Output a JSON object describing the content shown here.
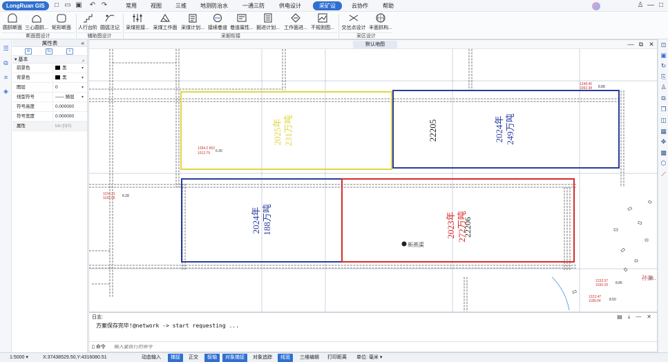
{
  "app": {
    "logo": "LongRuan GIS"
  },
  "menus": [
    {
      "label": "常用"
    },
    {
      "label": "视图"
    },
    {
      "label": "三维"
    },
    {
      "label": "地测防治水"
    },
    {
      "label": "一通三防"
    },
    {
      "label": "供电设计"
    },
    {
      "label": "采矿设计",
      "active": true
    },
    {
      "label": "云协作"
    },
    {
      "label": "帮助"
    }
  ],
  "ribbon": {
    "buttons": [
      "圆拱断面",
      "三心圆拱...",
      "矩形断面",
      "人行台阶",
      "圆弧注记",
      "采煤拒接...",
      "采煤工作面",
      "采煤计划...",
      "接续巷道",
      "巷道属性...",
      "掘进计划...",
      "工作面进...",
      "不规则图...",
      "交岔点设计",
      "丰面拱构..."
    ],
    "groups": [
      "断面图设计",
      "辅助图设计",
      "采掘衔接",
      "采区设计"
    ]
  },
  "props": {
    "title": "属性表",
    "collapse": "«",
    "tabs": [
      "⊞",
      "Sy",
      "≡"
    ],
    "section": "基本",
    "rows": [
      {
        "key": "前景色",
        "value": "黑",
        "swatch": true
      },
      {
        "key": "背景色",
        "value": "黑",
        "swatch": true
      },
      {
        "key": "图层",
        "value": "0"
      },
      {
        "key": "线型符号",
        "value": "—— 随层"
      },
      {
        "key": "符号高度",
        "value": "0.000000"
      },
      {
        "key": "符号宽度",
        "value": "0.000000"
      },
      {
        "key": "属性",
        "value": "bin:[0|0]"
      }
    ]
  },
  "map": {
    "tab": "默认地图",
    "labels": {
      "yellow": [
        "2025年",
        "231万吨"
      ],
      "blue_top": [
        "2024年",
        "249万吨"
      ],
      "id_top": "22205",
      "blue_left": [
        "2024年",
        "188万吨"
      ],
      "red": [
        "2023年",
        "272万吨"
      ],
      "id_red": "22206",
      "place1": "新燕渠",
      "place2": "孙家…",
      "pt1": "1284.2 852",
      "pt1b": "1012.79",
      "pt1v": "6.30",
      "pt2": "1248.45",
      "pt2b": "1092.38",
      "pt2v": "8.88",
      "pt3": "1154.21",
      "pt3b": "1182.06",
      "pt3v": "8.28",
      "pt4": "1232.57",
      "pt4b": "1030.29",
      "pt4v": "8.85",
      "pt5": "1222.47",
      "pt5b": "1189.04",
      "pt5v": "8.50"
    }
  },
  "log": {
    "title": "日志:",
    "text": "方案保存完毕!@network -> start requesting ...",
    "cmd_label": "命令",
    "cmd_placeholder": "输入要执行的命令"
  },
  "status": {
    "scale": "1:5000",
    "coords": "X:37438529.50,Y:4316080.51",
    "items": [
      {
        "label": "动态输入",
        "on": false
      },
      {
        "label": "捕捉",
        "on": true
      },
      {
        "label": "正交",
        "on": false
      },
      {
        "label": "极轴",
        "on": true
      },
      {
        "label": "对象捕捉",
        "on": true
      },
      {
        "label": "对象追踪",
        "on": false
      },
      {
        "label": "线宽",
        "on": true
      },
      {
        "label": "三维编辑",
        "on": false
      },
      {
        "label": "打印距离",
        "on": false
      }
    ],
    "unit": "单位: 毫米"
  },
  "colors": {
    "accent": "#2f6fd1",
    "yellow": "#e0d640",
    "blue": "#2a3c9c",
    "red": "#d62a2a"
  }
}
